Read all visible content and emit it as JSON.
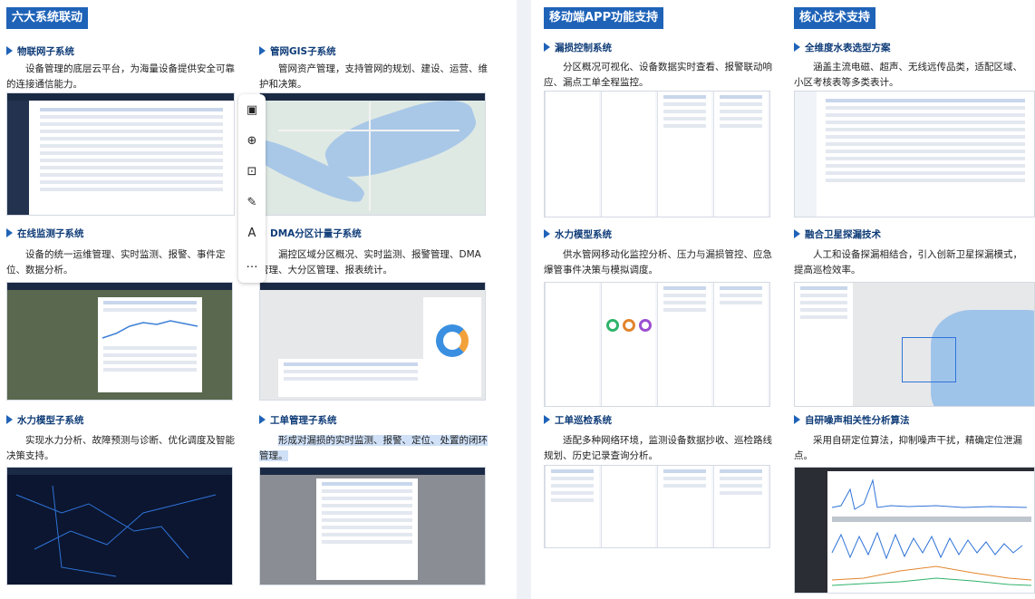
{
  "left_panel": {
    "section_title": "六大系统联动",
    "items": [
      {
        "title": "物联网子系统",
        "desc": "设备管理的底层云平台，为海量设备提供安全可靠的连接通信能力。"
      },
      {
        "title": "管网GIS子系统",
        "desc": "管网资产管理，支持管网的规划、建设、运营、维护和决策。"
      },
      {
        "title": "在线监测子系统",
        "desc": "设备的统一运维管理、实时监测、报警、事件定位、数据分析。"
      },
      {
        "title": "DMA分区计量子系统",
        "desc": "漏控区域分区概况、实时监测、报警管理、DMA管理、大分区管理、报表统计。"
      },
      {
        "title": "水力模型子系统",
        "desc": "实现水力分析、故障预测与诊断、优化调度及智能决策支持。"
      },
      {
        "title": "工单管理子系统",
        "desc": "形成对漏损的实时监测、报警、定位、处置的闭环管理。"
      }
    ]
  },
  "mid_panel": {
    "section_title": "移动端APP功能支持",
    "items": [
      {
        "title": "漏损控制系统",
        "desc": "分区概况可视化、设备数据实时查看、报警联动响应、漏点工单全程监控。"
      },
      {
        "title": "水力模型系统",
        "desc": "供水管网移动化监控分析、压力与漏损管控、应急爆管事件决策与模拟调度。"
      },
      {
        "title": "工单巡检系统",
        "desc": "适配多种网络环境，监测设备数据抄收、巡检路线规划、历史记录查询分析。"
      }
    ]
  },
  "right_panel": {
    "section_title": "核心技术支持",
    "items": [
      {
        "title": "全维度水表选型方案",
        "desc": "涵盖主流电磁、超声、无线远传品类，适配区域、小区考核表等多类表计。"
      },
      {
        "title": "融合卫星探漏技术",
        "desc": "人工和设备探漏相结合，引入创新卫星探漏模式，提高巡检效率。"
      },
      {
        "title": "自研噪声相关性分析算法",
        "desc": "采用自研定位算法，抑制噪声干扰，精确定位泄漏点。"
      }
    ]
  },
  "floating_toolbar": {
    "icons": [
      "image-icon",
      "zoom-in-icon",
      "image-search-icon",
      "image-edit-icon",
      "text-select-icon",
      "more-icon"
    ],
    "more_label": "…"
  },
  "colors": {
    "accent": "#1f63b8",
    "title_text": "#0f3c78"
  }
}
